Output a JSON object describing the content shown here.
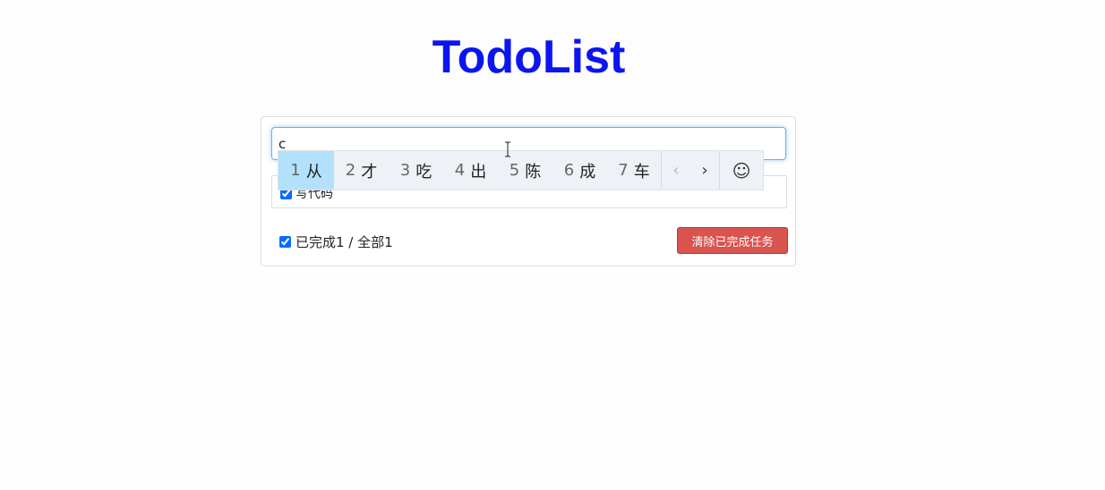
{
  "title": "TodoList",
  "input": {
    "value": "c",
    "placeholder": ""
  },
  "todos": [
    {
      "label": "写代码",
      "checked": true
    }
  ],
  "footer": {
    "summary": "已完成1 / 全部1",
    "all_checked": true,
    "clear_button_label": "清除已完成任务"
  },
  "ime": {
    "candidates": [
      {
        "num": "1",
        "text": "从"
      },
      {
        "num": "2",
        "text": "才"
      },
      {
        "num": "3",
        "text": "吃"
      },
      {
        "num": "4",
        "text": "出"
      },
      {
        "num": "5",
        "text": "陈"
      },
      {
        "num": "6",
        "text": "成"
      },
      {
        "num": "7",
        "text": "车"
      }
    ],
    "prev_icon": "‹",
    "next_icon": "›",
    "emoji_icon": "☺"
  },
  "colors": {
    "title": "#0b15f0",
    "danger": "#d9534f",
    "focus": "#66afe9",
    "candidate_selected": "#b3e1fb"
  }
}
